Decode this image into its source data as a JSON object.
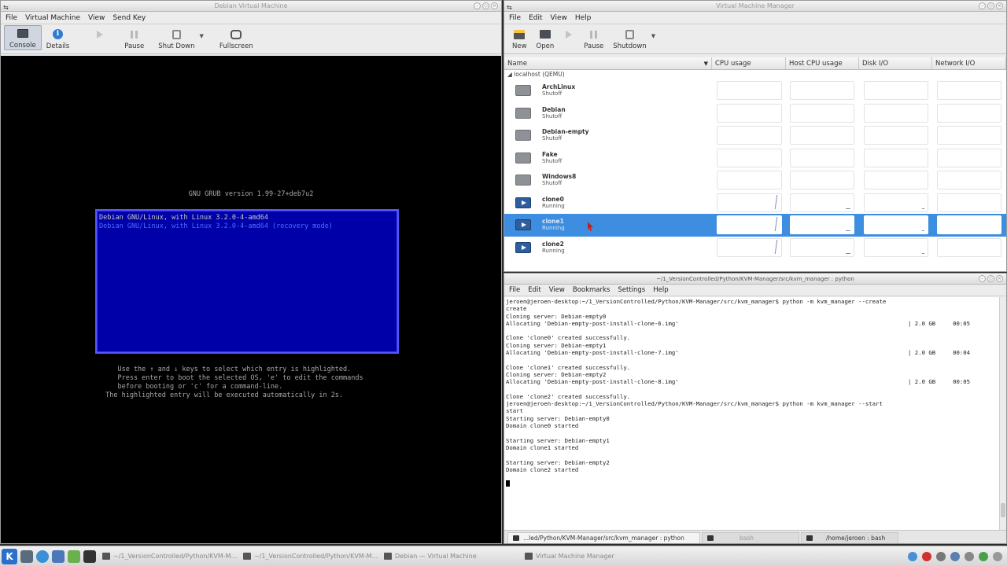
{
  "vm_window": {
    "title": "Debian Virtual Machine",
    "menu": [
      "File",
      "Virtual Machine",
      "View",
      "Send Key"
    ],
    "toolbar": {
      "console": "Console",
      "details": "Details",
      "pause": "Pause",
      "shutdown": "Shut Down",
      "fullscreen": "Fullscreen"
    }
  },
  "grub": {
    "title": "GNU GRUB  version 1.99-27+deb7u2",
    "entries": [
      "Debian GNU/Linux, with Linux 3.2.0-4-amd64",
      "Debian GNU/Linux, with Linux 3.2.0-4-amd64 (recovery mode)"
    ],
    "help": "    Use the ↑ and ↓ keys to select which entry is highlighted.\n    Press enter to boot the selected OS, 'e' to edit the commands\n    before booting or 'c' for a command-line.\n The highlighted entry will be executed automatically in 2s."
  },
  "vmm": {
    "title": "Virtual Machine Manager",
    "menu": [
      "File",
      "Edit",
      "View",
      "Help"
    ],
    "toolbar": {
      "new": "New",
      "open": "Open",
      "pause": "Pause",
      "shutdown": "Shutdown"
    },
    "columns": [
      "Name",
      "CPU usage",
      "Host CPU usage",
      "Disk I/O",
      "Network I/O"
    ],
    "group": "localhost (QEMU)",
    "vms": [
      {
        "name": "ArchLinux",
        "state": "Shutoff",
        "running": false
      },
      {
        "name": "Debian",
        "state": "Shutoff",
        "running": false
      },
      {
        "name": "Debian-empty",
        "state": "Shutoff",
        "running": false
      },
      {
        "name": "Fake",
        "state": "Shutoff",
        "running": false
      },
      {
        "name": "Windows8",
        "state": "Shutoff",
        "running": false
      },
      {
        "name": "clone0",
        "state": "Running",
        "running": true
      },
      {
        "name": "clone1",
        "state": "Running",
        "running": true
      },
      {
        "name": "clone2",
        "state": "Running",
        "running": true
      }
    ],
    "selected": "clone1"
  },
  "terminal": {
    "title": "~/1_VersionControlled/Python/KVM-Manager/src/kvm_manager : python",
    "menu": [
      "File",
      "Edit",
      "View",
      "Bookmarks",
      "Settings",
      "Help"
    ],
    "lines": [
      {
        "text": "jeroen@jeroen-desktop:~/1_VersionControlled/Python/KVM-Manager/src/kvm_manager$ python -m kvm_manager --create",
        "right": ""
      },
      {
        "text": "create",
        "right": ""
      },
      {
        "text": "Cloning server: Debian-empty0",
        "right": ""
      },
      {
        "text": "Allocating 'Debian-empty-post-install-clone-6.img'",
        "right": "| 2.0 GB     00:05"
      },
      {
        "text": "",
        "right": ""
      },
      {
        "text": "Clone 'clone0' created successfully.",
        "right": ""
      },
      {
        "text": "Cloning server: Debian-empty1",
        "right": ""
      },
      {
        "text": "Allocating 'Debian-empty-post-install-clone-7.img'",
        "right": "| 2.0 GB     00:04"
      },
      {
        "text": "",
        "right": ""
      },
      {
        "text": "Clone 'clone1' created successfully.",
        "right": ""
      },
      {
        "text": "Cloning server: Debian-empty2",
        "right": ""
      },
      {
        "text": "Allocating 'Debian-empty-post-install-clone-8.img'",
        "right": "| 2.0 GB     00:05"
      },
      {
        "text": "",
        "right": ""
      },
      {
        "text": "Clone 'clone2' created successfully.",
        "right": ""
      },
      {
        "text": "jeroen@jeroen-desktop:~/1_VersionControlled/Python/KVM-Manager/src/kvm_manager$ python -m kvm_manager --start",
        "right": ""
      },
      {
        "text": "start",
        "right": ""
      },
      {
        "text": "Starting server: Debian-empty0",
        "right": ""
      },
      {
        "text": "Domain clone0 started",
        "right": ""
      },
      {
        "text": "",
        "right": ""
      },
      {
        "text": "Starting server: Debian-empty1",
        "right": ""
      },
      {
        "text": "Domain clone1 started",
        "right": ""
      },
      {
        "text": "",
        "right": ""
      },
      {
        "text": "Starting server: Debian-empty2",
        "right": ""
      },
      {
        "text": "Domain clone2 started",
        "right": ""
      },
      {
        "text": "",
        "right": ""
      }
    ],
    "tabs": [
      "...led/Python/KVM-Manager/src/kvm_manager : python",
      "bash",
      "/home/jeroen : bash"
    ]
  },
  "taskbar": {
    "tasks": [
      "~/1_VersionControlled/Python/KVM-M...",
      "~/1_VersionControlled/Python/KVM-M...",
      "Debian — Virtual Machine",
      "Virtual Machine Manager"
    ]
  },
  "colors": {
    "grub_bg": "#0000a8",
    "selection": "#3d8ee0",
    "console_bg": "#000000"
  }
}
